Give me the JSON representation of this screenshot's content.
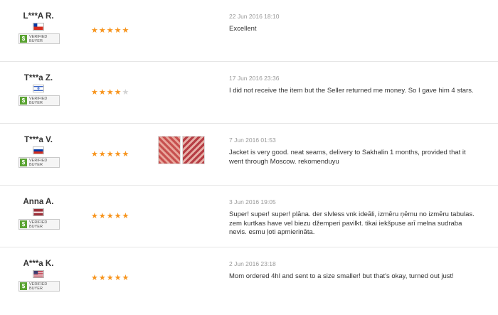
{
  "badge": {
    "line1": "VERIFIED",
    "line2": "BUYER",
    "icon": "$"
  },
  "colors": {
    "star_on": "#f7941d",
    "star_off": "#d3d3d3",
    "badge_green": "#5aa332"
  },
  "reviews": [
    {
      "name": "L***A R.",
      "flag_icon": "chile-flag-icon",
      "rating": 5,
      "date": "22 Jun 2016 18:10",
      "text": "Excellent",
      "photo_count": 0
    },
    {
      "name": "T***a Z.",
      "flag_icon": "israel-flag-icon",
      "rating": 4,
      "date": "17 Jun 2016 23:36",
      "text": "I did not receive the item but the Seller returned me money. So I gave him 4 stars.",
      "photo_count": 0
    },
    {
      "name": "T***a V.",
      "flag_icon": "russia-flag-icon",
      "rating": 5,
      "date": "7 Jun 2016 01:53",
      "text": "Jacket is very good. neat seams, delivery to Sakhalin 1 months, provided that it went through Moscow. rekomenduyu",
      "photo_count": 2
    },
    {
      "name": "Anna A.",
      "flag_icon": "latvia-flag-icon",
      "rating": 5,
      "date": "3 Jun 2016 19:05",
      "text": "Super! super! super! plāna. der slvless vnk ideāli, izmēru ņēmu no izmēru tabulas. zem kurtkas have vel biezu džemperi pavilkt. tikai iekšpuse arī melna sudraba nevis. esmu ļoti apmierināta.",
      "photo_count": 0
    },
    {
      "name": "A***a K.",
      "flag_icon": "usa-flag-icon",
      "rating": 5,
      "date": "2 Jun 2016 23:18",
      "text": "Mom ordered 4hl and sent to a size smaller! but that's okay, turned out just!",
      "photo_count": 0
    }
  ]
}
